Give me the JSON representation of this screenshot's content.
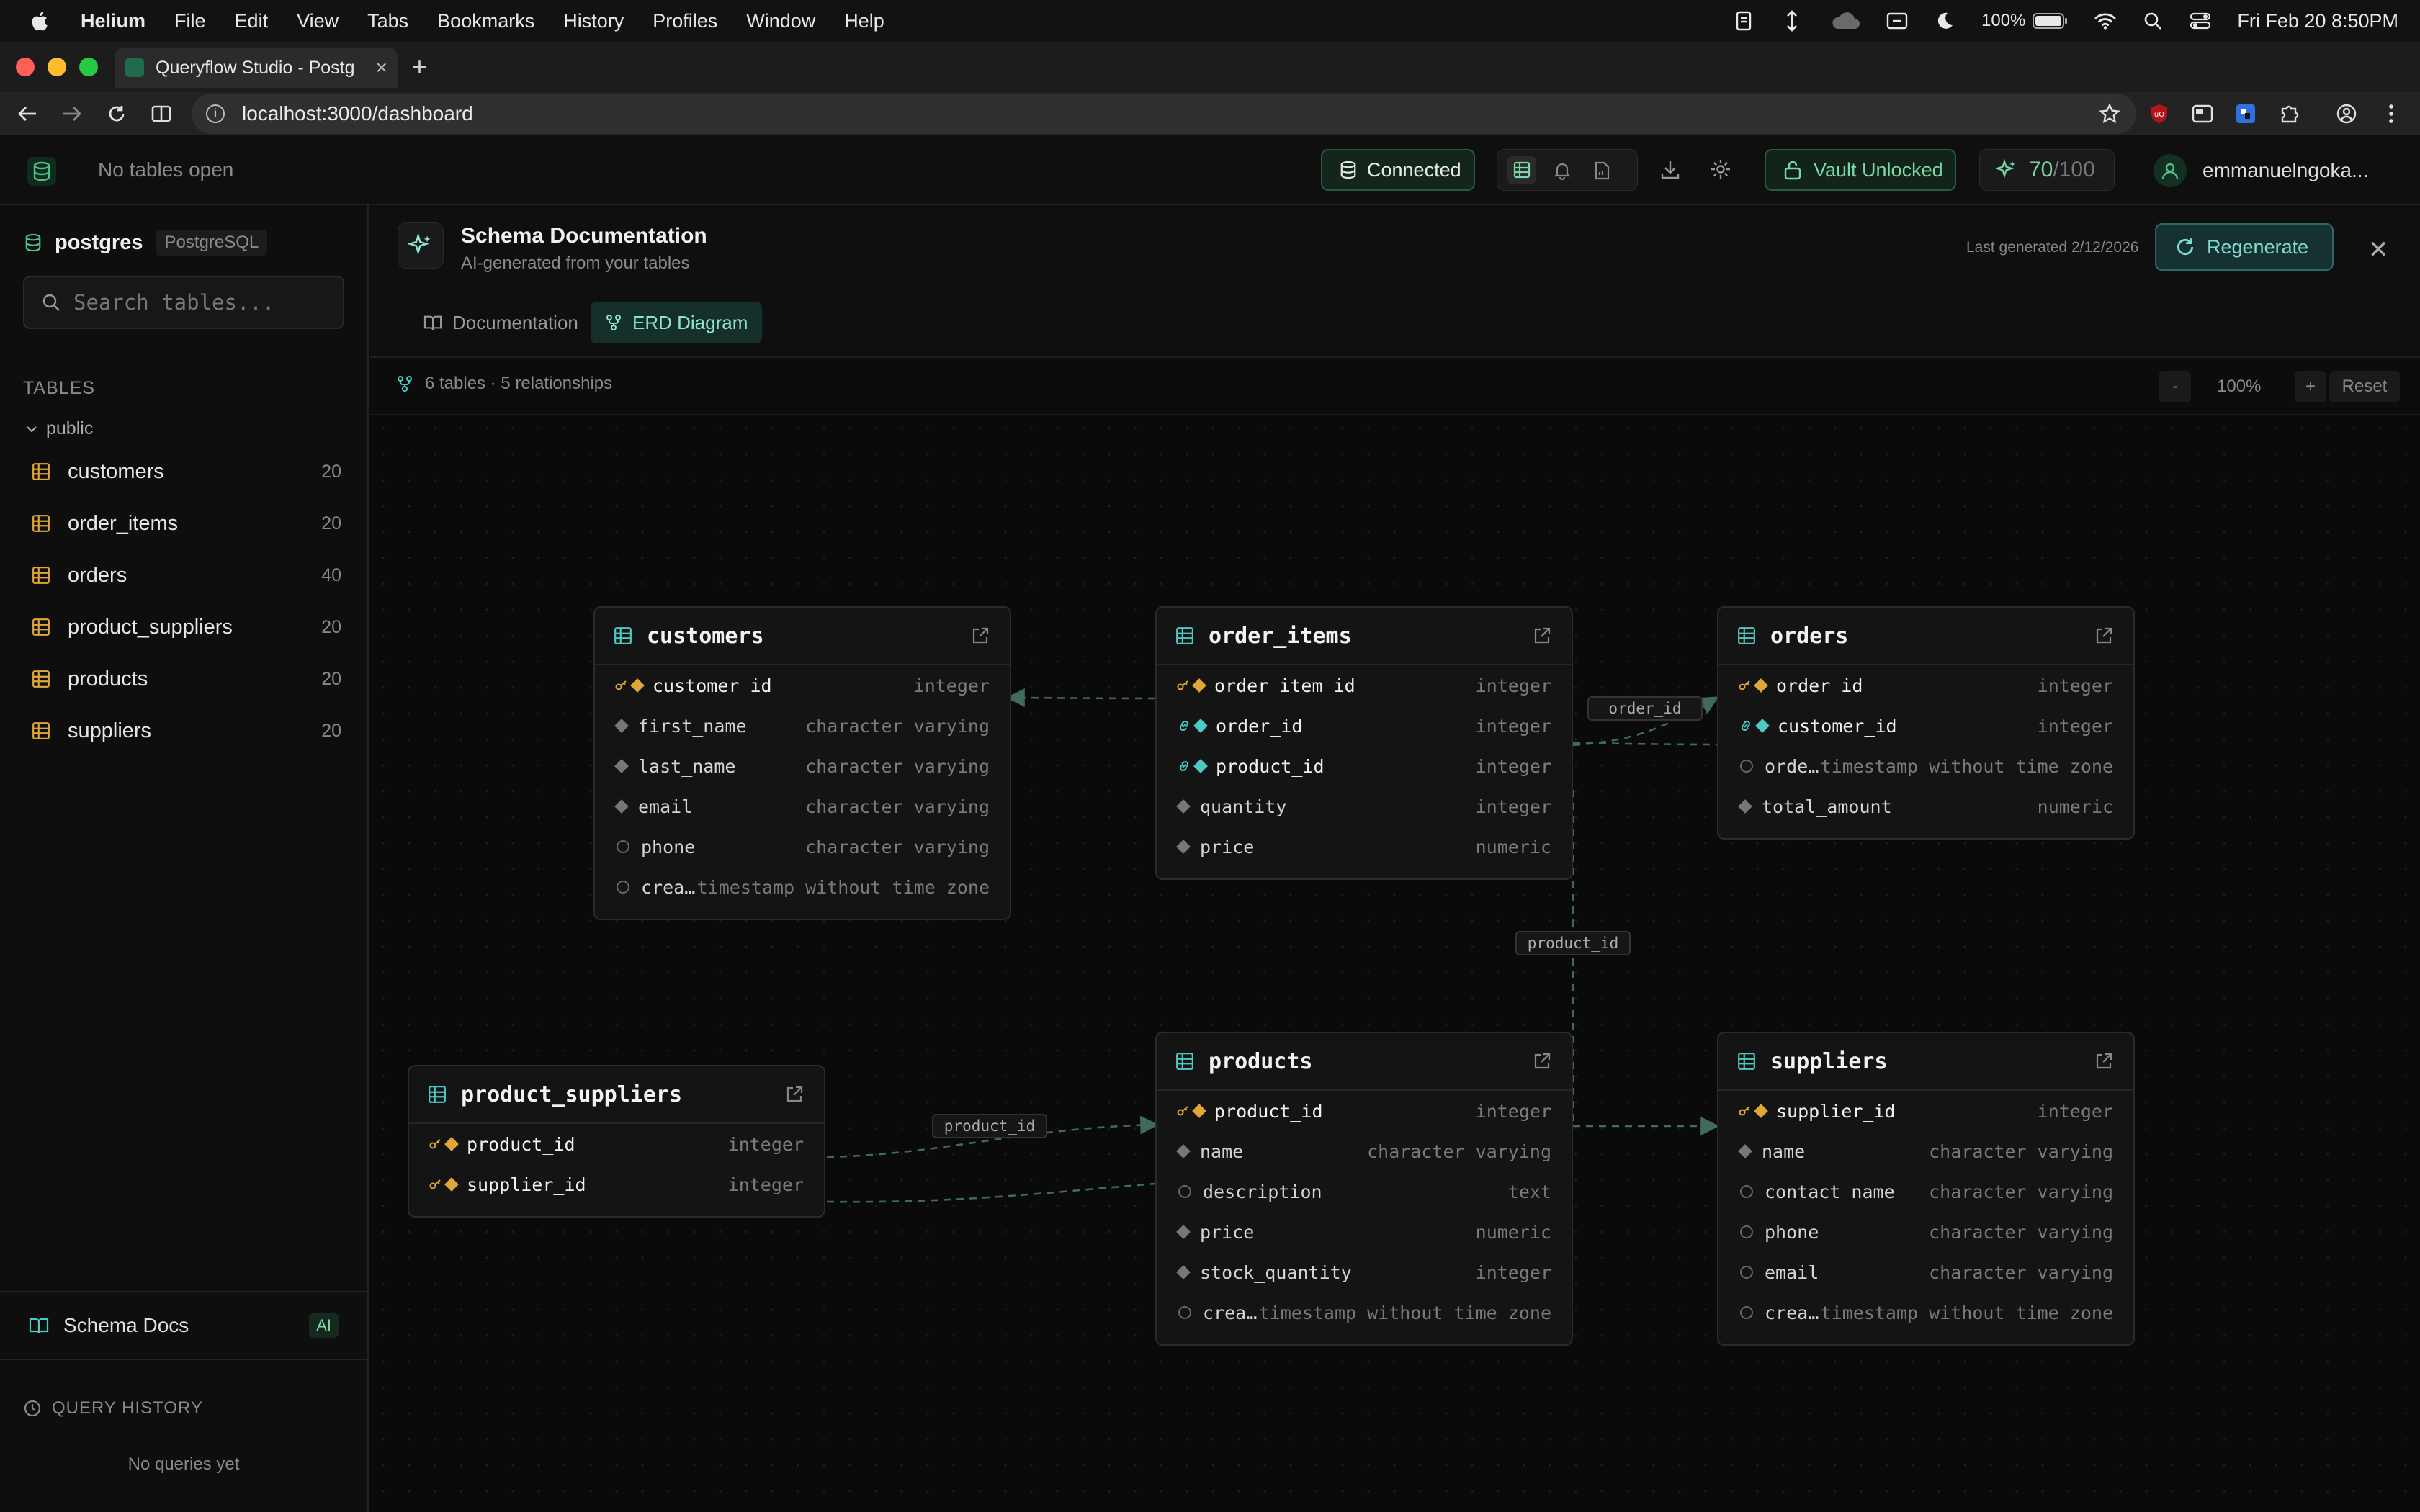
{
  "menubar": {
    "app": "Helium",
    "items": [
      "File",
      "Edit",
      "View",
      "Tabs",
      "Bookmarks",
      "History",
      "Profiles",
      "Window",
      "Help"
    ],
    "battery": "100%",
    "clock": "Fri Feb 20  8:50PM"
  },
  "browser": {
    "tab_title": "Queryflow Studio - Postg",
    "url": "localhost:3000/dashboard"
  },
  "header": {
    "no_tables": "No tables open",
    "connection": "Connected",
    "vault": "Vault Unlocked",
    "score": "70",
    "score_den": "/100",
    "user": "emmanuelngoka..."
  },
  "sidebar": {
    "db_name": "postgres",
    "db_type": "PostgreSQL",
    "search_placeholder": "Search tables...",
    "tables_label": "TABLES",
    "schema": "public",
    "tables": [
      {
        "name": "customers",
        "count": "20"
      },
      {
        "name": "order_items",
        "count": "20"
      },
      {
        "name": "orders",
        "count": "40"
      },
      {
        "name": "product_suppliers",
        "count": "20"
      },
      {
        "name": "products",
        "count": "20"
      },
      {
        "name": "suppliers",
        "count": "20"
      }
    ],
    "schema_docs": "Schema Docs",
    "ai_badge": "AI",
    "query_history_label": "QUERY HISTORY",
    "no_queries": "No queries yet"
  },
  "doc": {
    "title": "Schema Documentation",
    "subtitle": "AI-generated from your tables",
    "last_generated": "Last generated 2/12/2026",
    "regenerate": "Regenerate",
    "tabs": {
      "documentation": "Documentation",
      "erd": "ERD Diagram"
    },
    "stats": "6 tables · 5 relationships",
    "zoom_minus": "-",
    "zoom": "100%",
    "zoom_plus": "+",
    "reset": "Reset"
  },
  "erd": {
    "customers": {
      "name": "customers",
      "fields": [
        {
          "name": "customer_id",
          "type": "integer",
          "kind": "pk"
        },
        {
          "name": "first_name",
          "type": "character varying",
          "kind": "req"
        },
        {
          "name": "last_name",
          "type": "character varying",
          "kind": "req"
        },
        {
          "name": "email",
          "type": "character varying",
          "kind": "req"
        },
        {
          "name": "phone",
          "type": "character varying",
          "kind": "null"
        },
        {
          "name": "crea…",
          "type": "timestamp without time zone",
          "kind": "null"
        }
      ]
    },
    "order_items": {
      "name": "order_items",
      "fields": [
        {
          "name": "order_item_id",
          "type": "integer",
          "kind": "pk"
        },
        {
          "name": "order_id",
          "type": "integer",
          "kind": "fk"
        },
        {
          "name": "product_id",
          "type": "integer",
          "kind": "fk"
        },
        {
          "name": "quantity",
          "type": "integer",
          "kind": "req"
        },
        {
          "name": "price",
          "type": "numeric",
          "kind": "req"
        }
      ]
    },
    "orders": {
      "name": "orders",
      "fields": [
        {
          "name": "order_id",
          "type": "integer",
          "kind": "pk"
        },
        {
          "name": "customer_id",
          "type": "integer",
          "kind": "fk"
        },
        {
          "name": "orde…",
          "type": "timestamp without time zone",
          "kind": "null"
        },
        {
          "name": "total_amount",
          "type": "numeric",
          "kind": "req"
        }
      ]
    },
    "product_suppliers": {
      "name": "product_suppliers",
      "fields": [
        {
          "name": "product_id",
          "type": "integer",
          "kind": "pk"
        },
        {
          "name": "supplier_id",
          "type": "integer",
          "kind": "pk"
        }
      ]
    },
    "products": {
      "name": "products",
      "fields": [
        {
          "name": "product_id",
          "type": "integer",
          "kind": "pk"
        },
        {
          "name": "name",
          "type": "character varying",
          "kind": "req"
        },
        {
          "name": "description",
          "type": "text",
          "kind": "null"
        },
        {
          "name": "price",
          "type": "numeric",
          "kind": "req"
        },
        {
          "name": "stock_quantity",
          "type": "integer",
          "kind": "req"
        },
        {
          "name": "crea…",
          "type": "timestamp without time zone",
          "kind": "null"
        }
      ]
    },
    "suppliers": {
      "name": "suppliers",
      "fields": [
        {
          "name": "supplier_id",
          "type": "integer",
          "kind": "pk"
        },
        {
          "name": "name",
          "type": "character varying",
          "kind": "req"
        },
        {
          "name": "contact_name",
          "type": "character varying",
          "kind": "null"
        },
        {
          "name": "phone",
          "type": "character varying",
          "kind": "null"
        },
        {
          "name": "email",
          "type": "character varying",
          "kind": "null"
        },
        {
          "name": "crea…",
          "type": "timestamp without time zone",
          "kind": "null"
        }
      ]
    },
    "edge_labels": {
      "order_id": "order_id",
      "product_id_v": "product_id",
      "product_id_ps": "product_id"
    }
  },
  "colors": {
    "accent": "#7bd7a4",
    "pk": "#e0a637",
    "fk": "#4fc9c4",
    "edge": "#3f6a5e"
  }
}
